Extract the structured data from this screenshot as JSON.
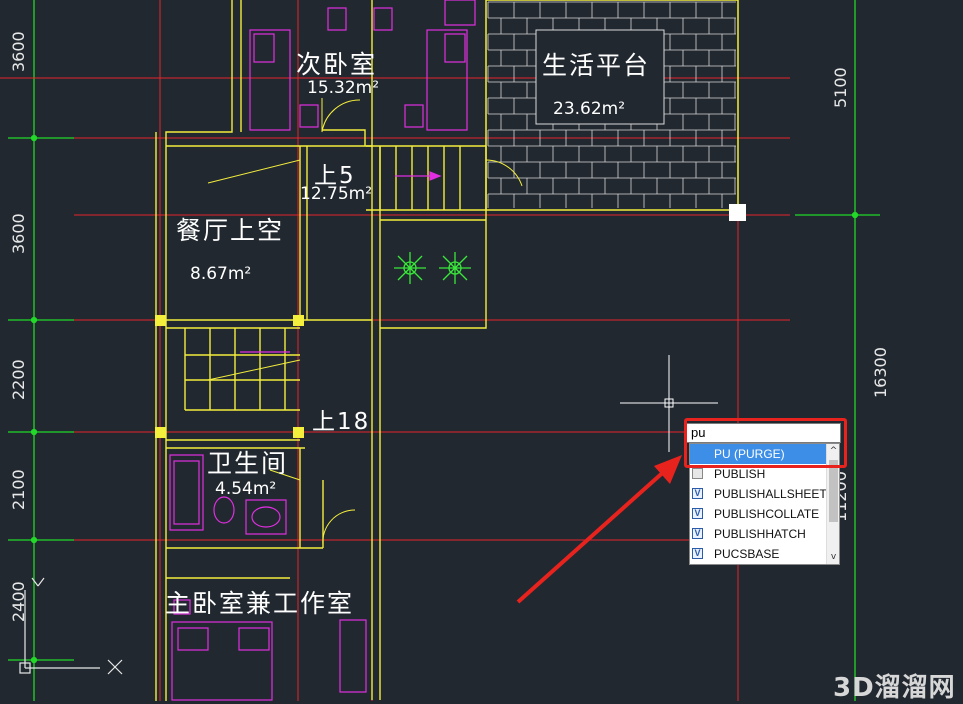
{
  "rooms": {
    "second_bedroom": {
      "name": "次卧室",
      "area": "15.32m²"
    },
    "balcony": {
      "name": "生活平台",
      "area": "23.62m²"
    },
    "stair_up5": {
      "label": "上5",
      "area": "12.75m²"
    },
    "dining_void": {
      "name": "餐厅上空",
      "area": "8.67m²"
    },
    "stair_up18": {
      "label": "上18"
    },
    "bathroom": {
      "name": "卫生间",
      "area": "4.54m²"
    },
    "master_bedroom": {
      "name": "主卧室兼工作室"
    }
  },
  "dimensions": {
    "left": [
      "3600",
      "3600",
      "2200",
      "2100",
      "2400"
    ],
    "right": [
      "5100",
      "16300",
      "11200"
    ]
  },
  "command": {
    "input_value": "pu",
    "suggestions": [
      {
        "label": "PU (PURGE)",
        "icon": "blank-icon",
        "selected": true
      },
      {
        "label": "PUBLISH",
        "icon": "publish-icon",
        "selected": false
      },
      {
        "label": "PUBLISHALLSHEETS",
        "icon": "variable-icon",
        "selected": false
      },
      {
        "label": "PUBLISHCOLLATE",
        "icon": "variable-icon",
        "selected": false
      },
      {
        "label": "PUBLISHHATCH",
        "icon": "variable-icon",
        "selected": false
      },
      {
        "label": "PUCSBASE",
        "icon": "variable-icon",
        "selected": false
      }
    ],
    "icon_letter": "V",
    "scroll_up": "^",
    "scroll_down": "v"
  },
  "watermark": "3D溜溜网",
  "colors": {
    "background": "#212830",
    "wall": "#f4ee3c",
    "axis": "#e8232a",
    "dimension": "#22d828",
    "furniture": "#e02ee0",
    "highlight": "#e8231e",
    "selection": "#3d8ee6"
  }
}
